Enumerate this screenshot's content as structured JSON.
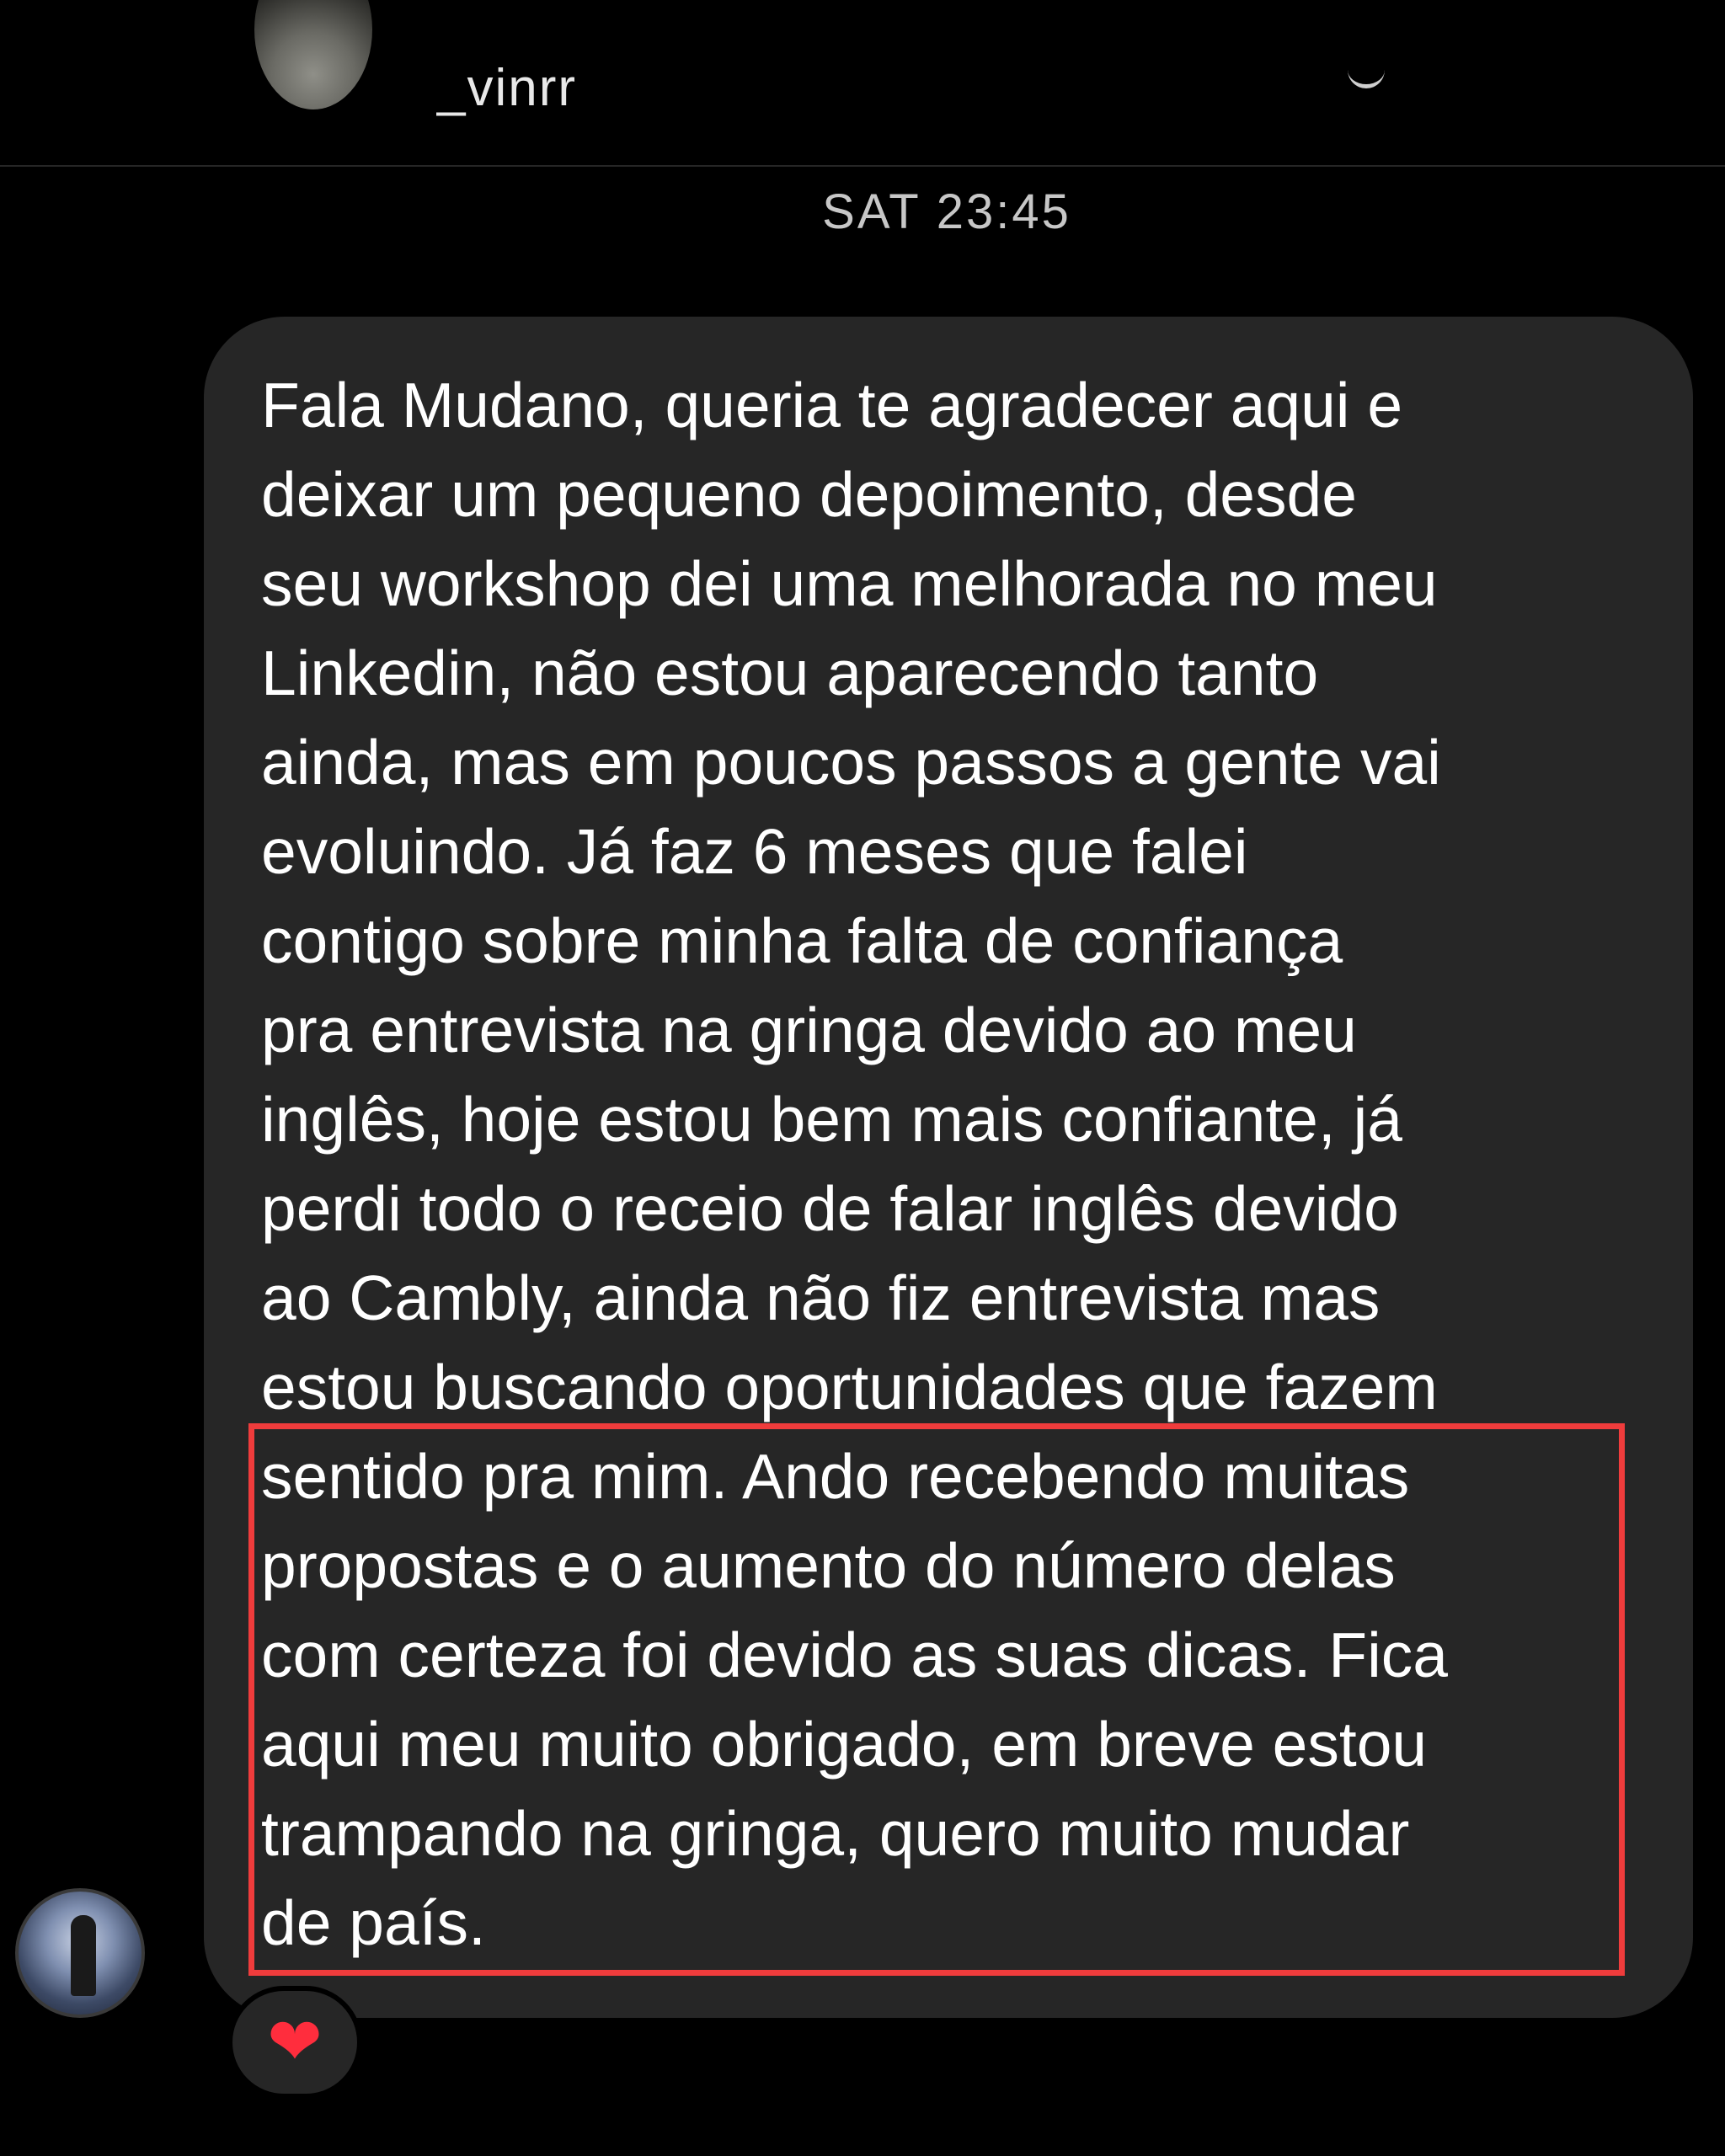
{
  "header": {
    "username": "_vinrr"
  },
  "thread": {
    "timestamp": "SAT 23:45",
    "message": {
      "lines": [
        "Fala Mudano, queria te agradecer aqui e",
        "deixar um pequeno depoimento, desde",
        "seu workshop dei uma melhorada no meu",
        "Linkedin, não estou aparecendo tanto",
        "ainda, mas em poucos passos a gente vai",
        "evoluindo. Já faz 6 meses que falei",
        "contigo sobre minha falta de confiança",
        "pra entrevista na gringa devido ao meu",
        "inglês, hoje estou bem mais confiante, já",
        "perdi todo o receio de falar inglês devido",
        "ao Cambly, ainda não fiz entrevista mas",
        "estou buscando oportunidades que fazem",
        "sentido pra mim. Ando recebendo muitas",
        "propostas e o aumento do número delas",
        "com certeza foi devido as suas dicas. Fica",
        "aqui meu muito obrigado, em breve estou",
        "trampando na gringa, quero muito mudar",
        "de país."
      ]
    },
    "reaction": {
      "emoji": "❤",
      "icon": "heart-icon"
    }
  },
  "colors": {
    "background": "#000000",
    "bubble": "#262626",
    "highlight": "#ef3c3c",
    "text": "#ffffff",
    "timestamp": "#c7c7c7"
  }
}
